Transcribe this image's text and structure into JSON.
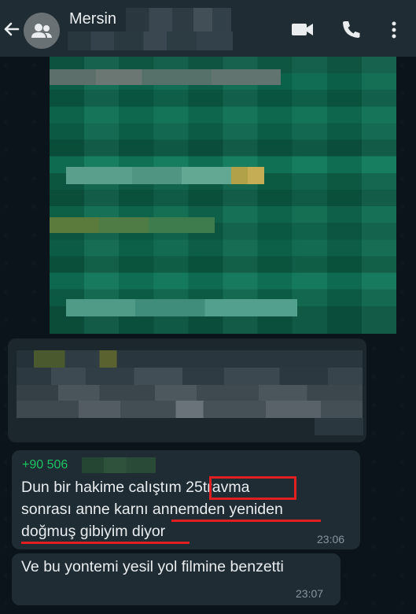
{
  "header": {
    "title": "Mersin",
    "back_icon": "arrow-left-icon",
    "avatar_icon": "group-icon",
    "actions": [
      "video-call-icon",
      "phone-icon",
      "more-vert-icon"
    ]
  },
  "messages": [
    {
      "sender": "+90 506",
      "lines": [
        "Dun bir hakime calıştım 25travma",
        "sonrası anne karnı annemden yeniden",
        "doğmuş gibiyim diyor"
      ],
      "time": "23:06"
    },
    {
      "text": "Ve bu yontemi yesil yol filmine benzetti",
      "time": "23:07"
    }
  ],
  "colors": {
    "app_bar": "#1f2c34",
    "background": "#0b141a",
    "bubble": "#1f2c34",
    "sender": "#1dc462",
    "annotation": "#e02020"
  }
}
